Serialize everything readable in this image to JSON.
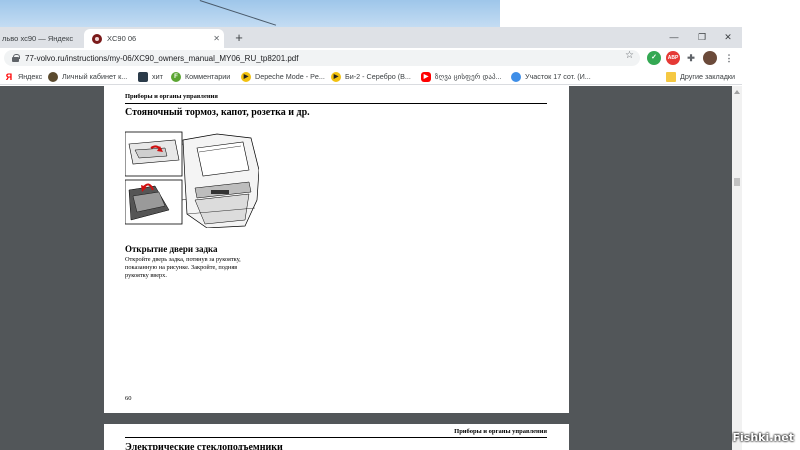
{
  "tabs": [
    {
      "label": "льво хс90 — Яндекс"
    },
    {
      "label": "XC90 06"
    }
  ],
  "address": {
    "url": "77-volvo.ru/instructions/my-06/XC90_owners_manual_MY06_RU_tp8201.pdf"
  },
  "bookmarks": [
    {
      "label": "Яндекс",
      "icon": "yandex-icon",
      "color": "#ff0000"
    },
    {
      "label": "Личный кабинет к...",
      "icon": "cabinet-icon",
      "color": "#5b4a2e"
    },
    {
      "label": "хит",
      "icon": "hit-icon",
      "color": "#2b3b4a"
    },
    {
      "label": "Комментарии",
      "icon": "comments-icon",
      "color": "#5ba532"
    },
    {
      "label": "Depeche Mode - Pe...",
      "icon": "play-icon",
      "color": "#f2c10f"
    },
    {
      "label": "Би-2 - Серебро (В...",
      "icon": "play-icon",
      "color": "#f2c10f"
    },
    {
      "label": "ზღვა ცისფერ დაპ...",
      "icon": "youtube-icon",
      "color": "#ff0000"
    },
    {
      "label": "Участок 17 сот. (И...",
      "icon": "avito-icon",
      "color": "#3e8ee8"
    }
  ],
  "other_bookmarks": "Другие закладки",
  "pdf": {
    "page1": {
      "header": "Приборы и органы управления",
      "title": "Стояночный тормоз, капот, розетка и др.",
      "section_title": "Открытие двери задка",
      "body_lines": [
        "Откройте дверь задка, потянув за рукоятку,",
        "показанную на рисунке. Закройте, подняв",
        "рукоятку вверх."
      ],
      "page_number": "60"
    },
    "page2": {
      "header": "Приборы и органы управления",
      "title": "Электрические стеклоподъемники"
    }
  },
  "watermark": "Fishki.net"
}
